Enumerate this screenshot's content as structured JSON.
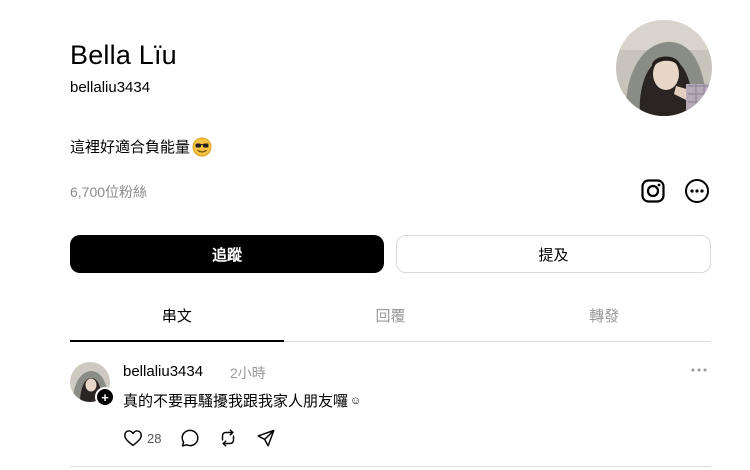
{
  "profile": {
    "name": "Bella Lïu",
    "handle": "bellaliu3434",
    "bio": "這裡好適合負能量",
    "bio_emoji": "sunglasses-emoji",
    "followers": "6,700位粉絲"
  },
  "buttons": {
    "follow_label": "追蹤",
    "mention_label": "提及"
  },
  "tabs": [
    {
      "label": "串文",
      "active": true
    },
    {
      "label": "回覆",
      "active": false
    },
    {
      "label": "轉發",
      "active": false
    }
  ],
  "post": {
    "username": "bellaliu3434",
    "time": "2小時",
    "text": "真的不要再騷擾我跟我家人朋友囉",
    "text_emoji": "☺",
    "likes": "28"
  },
  "icons": {
    "instagram": "instagram-icon",
    "more": "more-icon",
    "heart": "heart-icon",
    "comment": "comment-icon",
    "repost": "repost-icon",
    "share": "send-icon"
  }
}
